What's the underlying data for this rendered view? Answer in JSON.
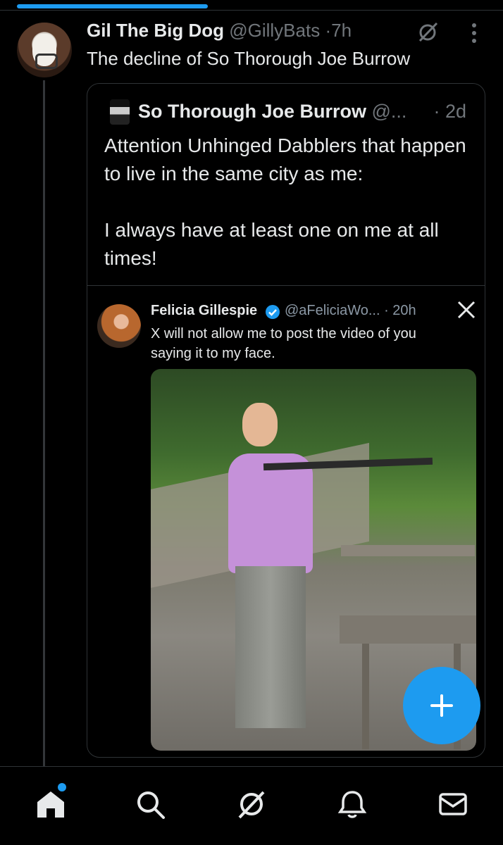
{
  "progress": {
    "value": 0.38,
    "color": "#1d9bf0"
  },
  "post": {
    "avatar_icon": "bull-terrier-avatar",
    "display_name": "Gil The Big Dog",
    "handle": "@GillyBats",
    "separator": "·",
    "time": "7h",
    "text": "The decline of So Thorough Joe Burrow"
  },
  "quote": {
    "display_name": "So Thorough Joe Burrow",
    "handle": "@...",
    "time": "· 2d",
    "body": [
      "Attention Unhinged Dabblers that happen to live in the same city as me:",
      "I always have at least one on me at all times!"
    ],
    "embed": {
      "display_name": "Felicia Gillespie",
      "handle_time": "@aFeliciaWo... · 20h",
      "text": "X will not allow me to post the video of you saying it to my face.",
      "verified_color": "#1d9bf0",
      "photo_description_icon": "photo"
    }
  },
  "fab": {
    "icon": "plus-icon",
    "color": "#1d9bf0"
  },
  "nav": {
    "items": [
      "home-icon",
      "search-icon",
      "grok-icon",
      "notifications-icon",
      "messages-icon"
    ],
    "active": "home-icon"
  }
}
